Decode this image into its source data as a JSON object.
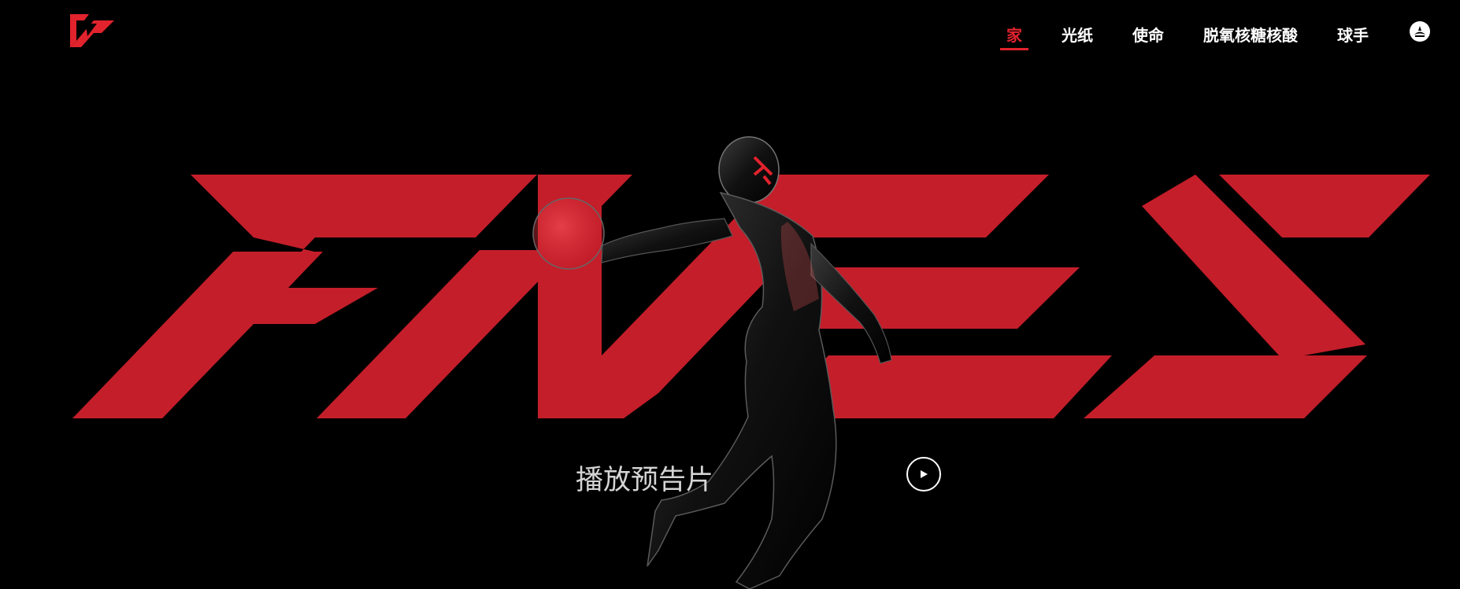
{
  "brand": {
    "logo_icon": "brand-logo-icon",
    "accent_color": "#c41e2a"
  },
  "nav": {
    "items": [
      {
        "label": "家",
        "active": true
      },
      {
        "label": "光纸",
        "active": false
      },
      {
        "label": "使命",
        "active": false
      },
      {
        "label": "脱氧核糖核酸",
        "active": false
      },
      {
        "label": "球手",
        "active": false
      }
    ],
    "lang_icon": "globe-icon"
  },
  "hero": {
    "wordmark": "FIVES",
    "trailer_label": "播放预告片",
    "play_icon": "play-icon"
  }
}
